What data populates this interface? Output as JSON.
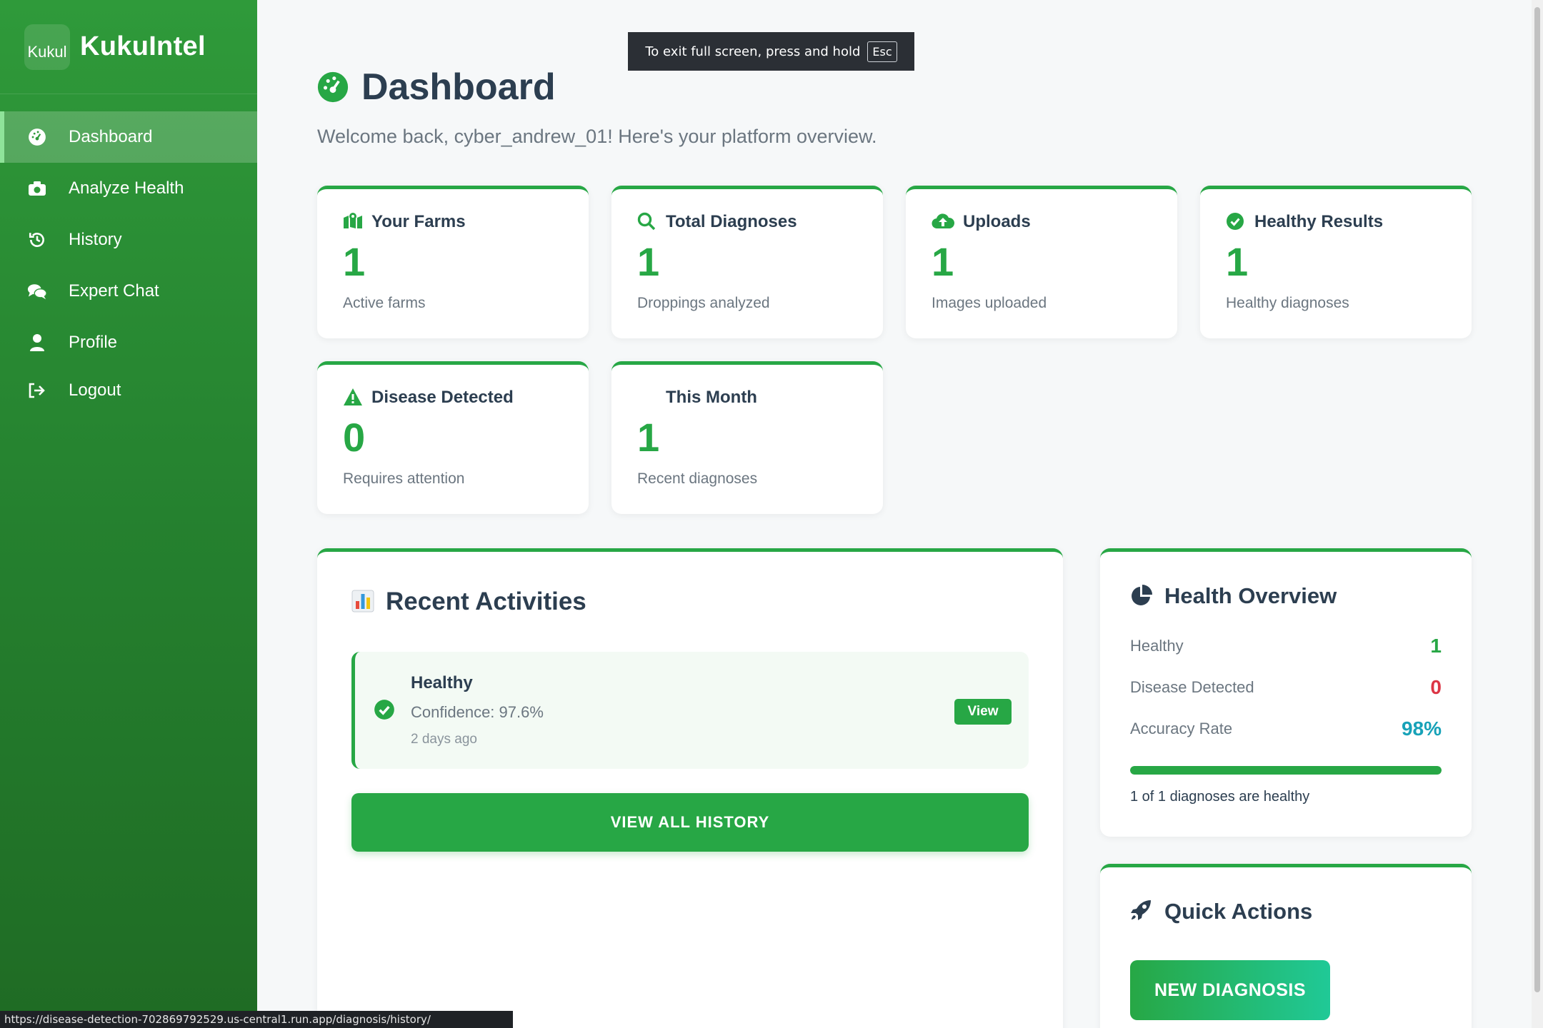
{
  "brand": {
    "logo_alt": "Kukul",
    "name": "KukuIntel"
  },
  "sidebar": {
    "items": [
      {
        "label": "Dashboard",
        "icon": "dashboard-icon",
        "active": true
      },
      {
        "label": "Analyze Health",
        "icon": "camera-icon"
      },
      {
        "label": "History",
        "icon": "history-icon"
      },
      {
        "label": "Expert Chat",
        "icon": "chat-icon"
      },
      {
        "label": "Profile",
        "icon": "user-icon"
      },
      {
        "label": "Logout",
        "icon": "logout-icon"
      }
    ]
  },
  "fullscreen_notice": {
    "text": "To exit full screen, press and hold",
    "key": "Esc"
  },
  "header": {
    "title": "Dashboard",
    "welcome": "Welcome back, cyber_andrew_01! Here's your platform overview."
  },
  "stats": [
    {
      "title": "Your Farms",
      "value": "1",
      "sub": "Active farms",
      "icon": "map-icon"
    },
    {
      "title": "Total Diagnoses",
      "value": "1",
      "sub": "Droppings analyzed",
      "icon": "search-icon"
    },
    {
      "title": "Uploads",
      "value": "1",
      "sub": "Images uploaded",
      "icon": "cloud-upload-icon"
    },
    {
      "title": "Healthy Results",
      "value": "1",
      "sub": "Healthy diagnoses",
      "icon": "check-circle-icon"
    },
    {
      "title": "Disease Detected",
      "value": "0",
      "sub": "Requires attention",
      "icon": "warning-icon"
    },
    {
      "title": "This Month",
      "value": "1",
      "sub": "Recent diagnoses",
      "icon": "calendar-icon"
    }
  ],
  "activities": {
    "title": "Recent Activities",
    "items": [
      {
        "status": "Healthy",
        "confidence": "Confidence: 97.6%",
        "time": "2 days ago",
        "button": "View"
      }
    ],
    "view_all": "VIEW ALL HISTORY"
  },
  "health_overview": {
    "title": "Health Overview",
    "rows": [
      {
        "label": "Healthy",
        "value": "1",
        "color": "#27a745"
      },
      {
        "label": "Disease Detected",
        "value": "0",
        "color": "#dc3545"
      },
      {
        "label": "Accuracy Rate",
        "value": "98%",
        "color": "#17a2b8"
      }
    ],
    "healthy_fraction": 1.0,
    "caption": "1 of 1 diagnoses are healthy"
  },
  "quick_actions": {
    "title": "Quick Actions",
    "new_diagnosis": "NEW DIAGNOSIS"
  },
  "status_bar": {
    "url": "https://disease-detection-702869792529.us-central1.run.app/diagnosis/history/"
  },
  "colors": {
    "accent": "#27a745",
    "danger": "#dc3545",
    "info": "#17a2b8",
    "sidebar": "#2f9a3a"
  }
}
